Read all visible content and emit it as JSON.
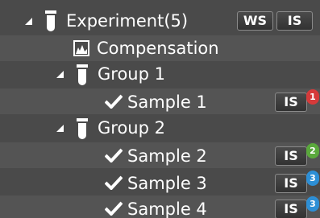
{
  "colors": {
    "background": "#4a4a4a",
    "row_alt": "#545454",
    "text": "#ffffff",
    "badge_red": "#d63a3a",
    "badge_green": "#5aa83c",
    "badge_blue": "#2d8fd6"
  },
  "tree": {
    "experiment": {
      "label": "Experiment(5)",
      "icon": "tube-icon",
      "ws_button": "WS",
      "is_button": "IS"
    },
    "compensation": {
      "label": "Compensation",
      "icon": "chart-icon"
    },
    "group1": {
      "label": "Group 1",
      "icon": "tube-icon"
    },
    "sample1": {
      "label": "Sample 1",
      "icon": "checkmark-icon",
      "is_button": "IS",
      "badge": "1"
    },
    "group2": {
      "label": "Group 2",
      "icon": "tube-icon"
    },
    "sample2": {
      "label": "Sample 2",
      "icon": "checkmark-icon",
      "is_button": "IS",
      "badge": "2"
    },
    "sample3": {
      "label": "Sample 3",
      "icon": "checkmark-icon",
      "is_button": "IS",
      "badge": "3"
    },
    "sample4": {
      "label": "Sample 4",
      "icon": "checkmark-icon",
      "is_button": "IS",
      "badge": "3"
    }
  }
}
